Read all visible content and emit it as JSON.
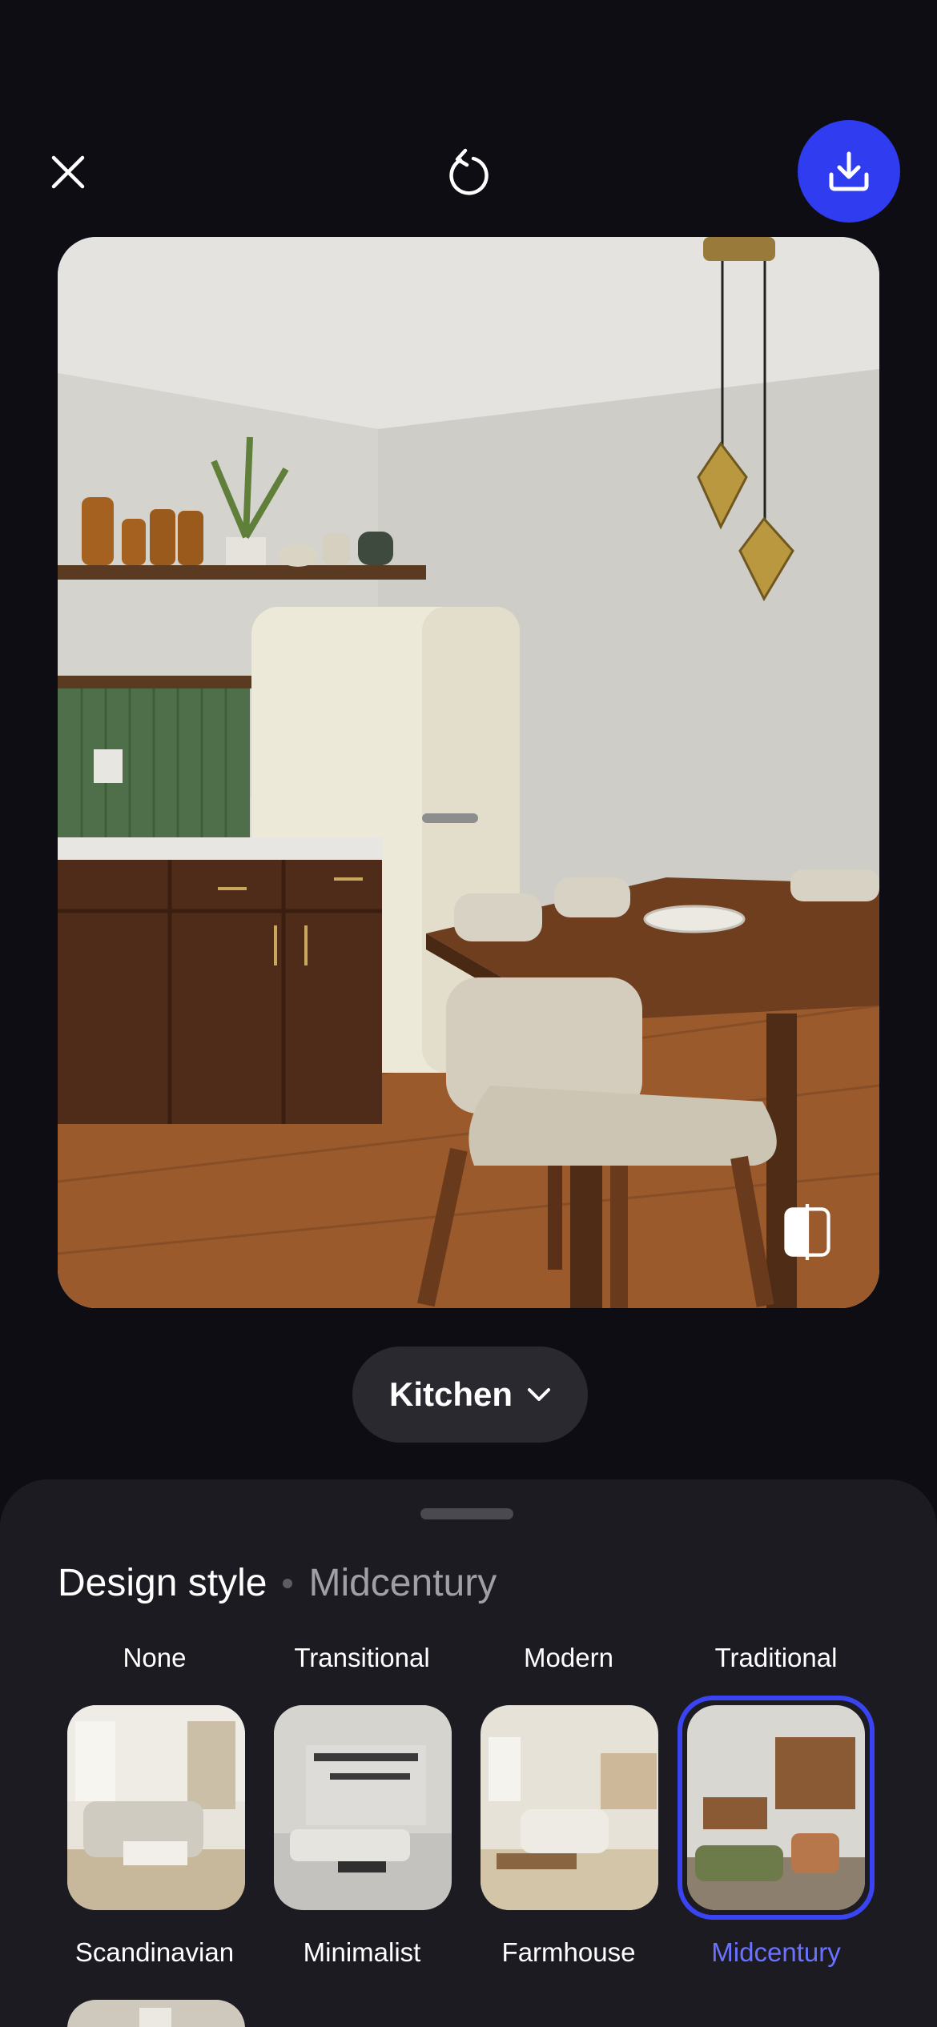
{
  "toolbar": {
    "close_icon": "close-icon",
    "reset_icon": "rotate-ccw-icon",
    "download_icon": "download-icon",
    "accent_color": "#2f3cf0"
  },
  "preview": {
    "compare_icon": "compare-split-icon"
  },
  "room_selector": {
    "value": "Kitchen",
    "icon": "chevron-down-icon"
  },
  "design_panel": {
    "title": "Design style",
    "selected_style": "Midcentury",
    "styles_top": [
      {
        "label": "None"
      },
      {
        "label": "Transitional"
      },
      {
        "label": "Modern"
      },
      {
        "label": "Traditional"
      }
    ],
    "styles_bottom": [
      {
        "label": "Scandinavian"
      },
      {
        "label": "Minimalist"
      },
      {
        "label": "Farmhouse"
      },
      {
        "label": "Midcentury",
        "selected": true
      }
    ],
    "selected_color": "#6a72ff"
  }
}
